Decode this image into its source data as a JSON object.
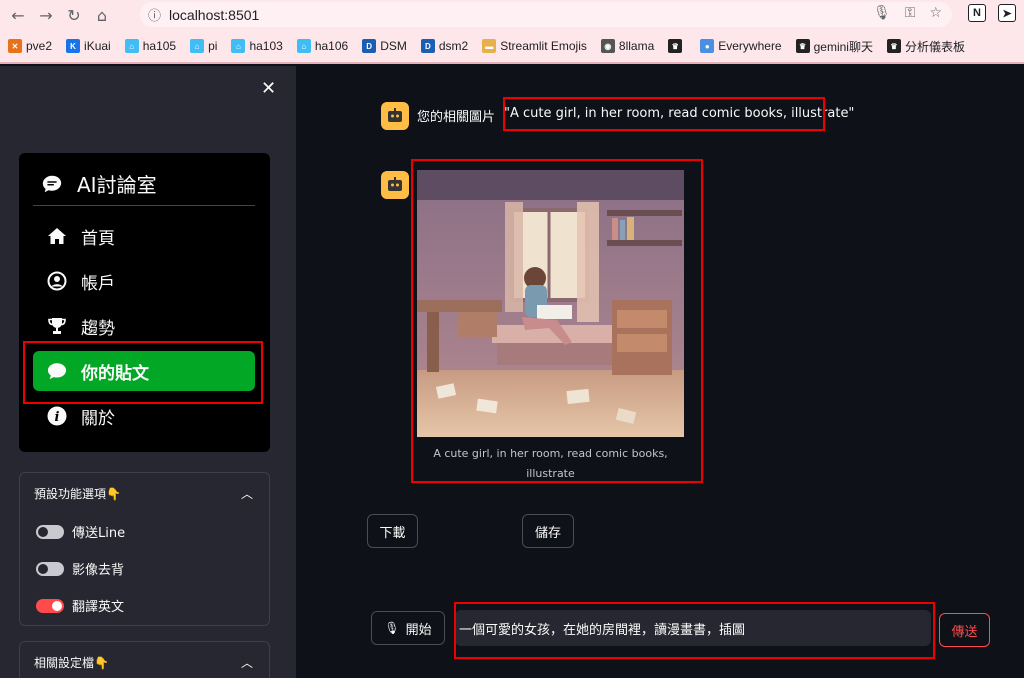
{
  "browser": {
    "url": "localhost:8501",
    "bookmarks": [
      {
        "label": "pve2",
        "icon": "x-icon",
        "color": "#e8711c"
      },
      {
        "label": "iKuai",
        "icon": "k-icon",
        "color": "#1a73e8"
      },
      {
        "label": "ha105",
        "icon": "home-assistant-icon",
        "color": "#41bdf5"
      },
      {
        "label": "pi",
        "icon": "home-assistant-icon",
        "color": "#41bdf5"
      },
      {
        "label": "ha103",
        "icon": "home-assistant-icon",
        "color": "#41bdf5"
      },
      {
        "label": "ha106",
        "icon": "home-assistant-icon",
        "color": "#41bdf5"
      },
      {
        "label": "DSM",
        "icon": "dsm-icon",
        "color": "#1a5fb4"
      },
      {
        "label": "dsm2",
        "icon": "dsm-icon",
        "color": "#1a5fb4"
      },
      {
        "label": "Streamlit Emojis",
        "icon": "folder-icon",
        "color": "#e8b04a"
      },
      {
        "label": "8llama",
        "icon": "llama-icon",
        "color": "#555555"
      },
      {
        "label": "",
        "icon": "crown-icon",
        "color": "#222222"
      },
      {
        "label": "Everywhere",
        "icon": "chat-bubble-icon",
        "color": "#4a90e2"
      },
      {
        "label": "gemini聊天",
        "icon": "crown-icon",
        "color": "#222222"
      },
      {
        "label": "分析儀表板",
        "icon": "crown-icon",
        "color": "#222222"
      }
    ]
  },
  "sidebar": {
    "menu_title": "AI討論室",
    "items": [
      {
        "label": "首頁",
        "icon": "home-icon"
      },
      {
        "label": "帳戶",
        "icon": "user-circle-icon"
      },
      {
        "label": "趨勢",
        "icon": "trophy-icon"
      },
      {
        "label": "你的貼文",
        "icon": "chat-icon"
      },
      {
        "label": "關於",
        "icon": "info-icon"
      }
    ],
    "active_index": 3,
    "active_color": "#03a726",
    "options_title": "預設功能選項👇",
    "toggles": [
      {
        "label": "傳送Line",
        "on": false
      },
      {
        "label": "影像去背",
        "on": false
      },
      {
        "label": "翻譯英文",
        "on": true
      }
    ],
    "config_title": "相關設定檔👇"
  },
  "chat": {
    "related_image_prefix": "您的相關圖片",
    "prompt_quote": "\"A cute girl, in her room, read comic books, illustrate\"",
    "image_caption": "A cute girl, in her room, read comic books, illustrate",
    "download_label": "下載",
    "save_label": "儲存",
    "mic_label": "開始",
    "input_value": "一個可愛的女孩，在她的房間裡，讀漫畫書，插圖",
    "send_label": "傳送",
    "accent_color": "#ff4b4b",
    "avatar_color": "#ffbd45"
  }
}
